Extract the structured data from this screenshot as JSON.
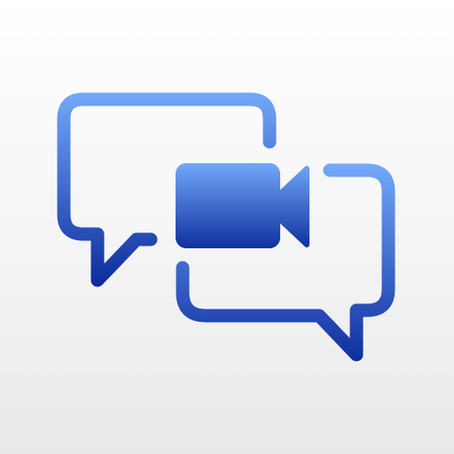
{
  "icon": {
    "name": "video-chat-app-icon",
    "elements": [
      "speech-bubble-outline-left",
      "speech-bubble-outline-right",
      "video-camera-icon"
    ]
  },
  "colors": {
    "background_top": "#ffffff",
    "background_bottom": "#e9e9ea",
    "gradient_light": "#75abfb",
    "gradient_dark": "#0d2d9e"
  }
}
